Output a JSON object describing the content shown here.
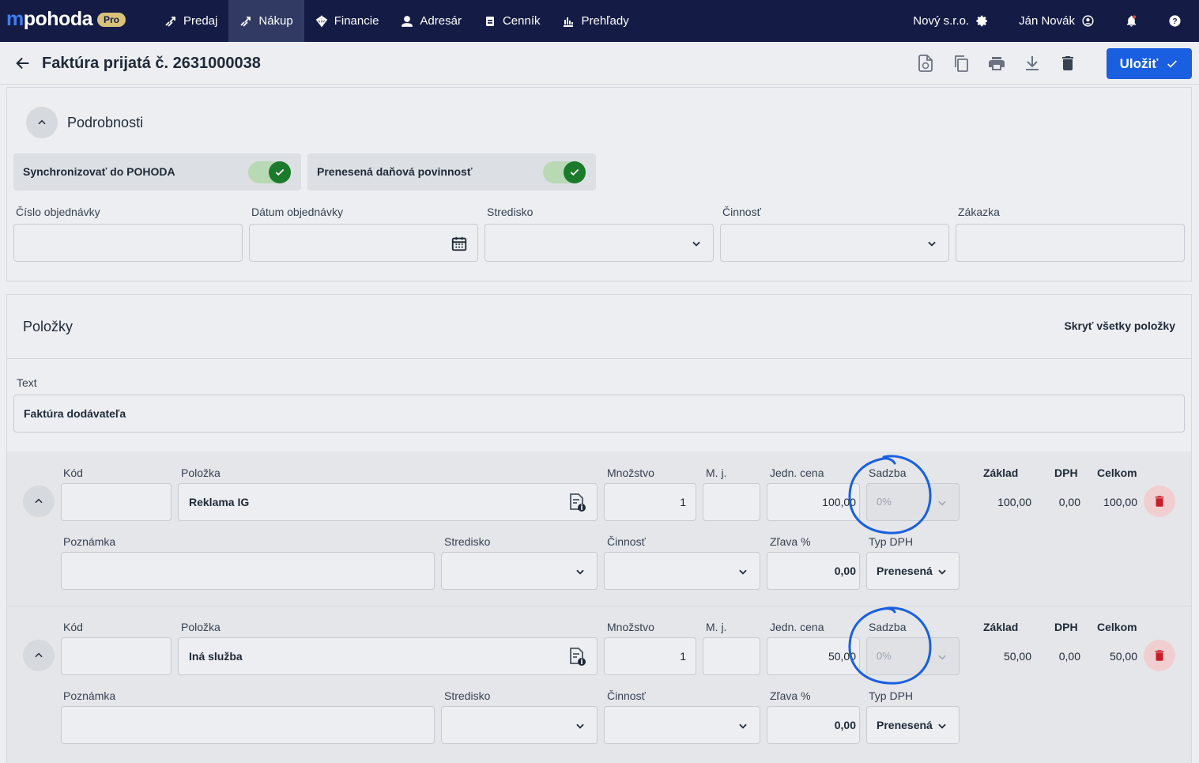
{
  "nav": {
    "logo": "pohoda",
    "logo_m": "m",
    "badge": "Pro",
    "items": [
      {
        "label": "Predaj",
        "icon": "sales-icon"
      },
      {
        "label": "Nákup",
        "icon": "purchase-icon",
        "active": true
      },
      {
        "label": "Financie",
        "icon": "finance-icon"
      },
      {
        "label": "Adresár",
        "icon": "person-icon"
      },
      {
        "label": "Cenník",
        "icon": "pricelist-icon"
      },
      {
        "label": "Prehľady",
        "icon": "chart-icon"
      }
    ],
    "company": "Nový s.r.o.",
    "user": "Ján Novák"
  },
  "header": {
    "title": "Faktúra prijatá č. 2631000038",
    "save_label": "Uložiť"
  },
  "details": {
    "title": "Podrobnosti",
    "toggle_sync": "Synchronizovať do POHODA",
    "toggle_reverse": "Prenesená daňová povinnosť",
    "fields": {
      "order_number": "Číslo objednávky",
      "order_date": "Dátum objednávky",
      "center": "Stredisko",
      "activity": "Činnosť",
      "contract": "Zákazka"
    }
  },
  "items": {
    "title": "Položky",
    "hide_all": "Skryť všetky položky",
    "text_label": "Text",
    "text_value": "Faktúra dodávateľa",
    "labels": {
      "code": "Kód",
      "item": "Položka",
      "qty": "Množstvo",
      "unit": "M. j.",
      "unit_price": "Jedn. cena",
      "rate": "Sadzba",
      "base": "Základ",
      "vat": "DPH",
      "total": "Celkom",
      "note": "Poznámka",
      "center": "Stredisko",
      "activity": "Činnosť",
      "discount": "Zľava %",
      "vat_type": "Typ DPH"
    },
    "rows": [
      {
        "name": "Reklama IG",
        "qty": "1",
        "unit_price": "100,00",
        "rate": "0%",
        "base": "100,00",
        "vat": "0,00",
        "total": "100,00",
        "discount": "0,00",
        "vat_type": "Prenesená"
      },
      {
        "name": "Iná služba",
        "qty": "1",
        "unit_price": "50,00",
        "rate": "0%",
        "base": "50,00",
        "vat": "0,00",
        "total": "50,00",
        "discount": "0,00",
        "vat_type": "Prenesená"
      }
    ]
  },
  "colors": {
    "nav_bg": "#141c45",
    "primary": "#1a5fe0",
    "toggle_on": "#1b7a2c",
    "delete": "#c81e2a",
    "annotation": "#1a5fe0"
  }
}
